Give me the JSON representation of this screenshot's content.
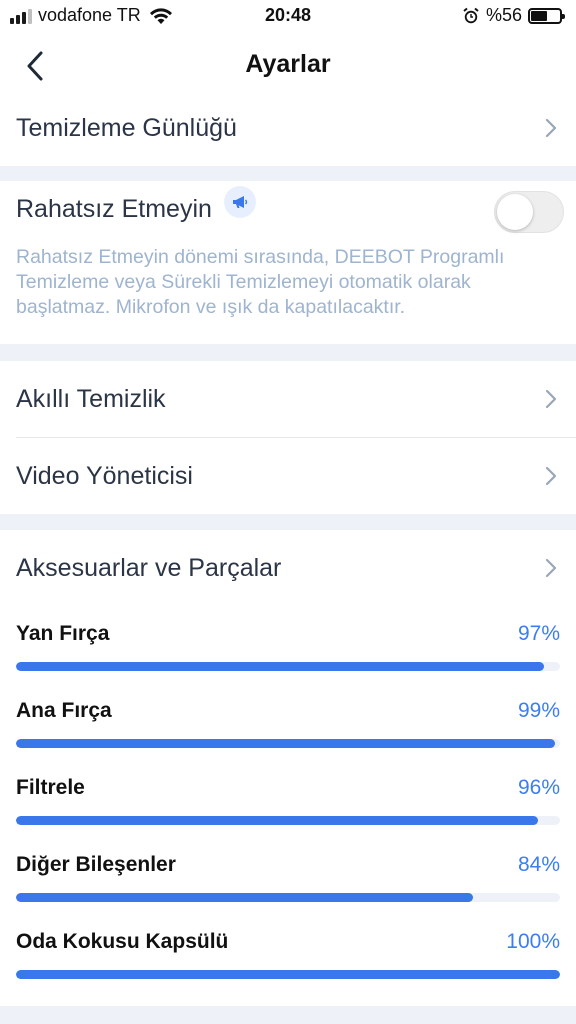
{
  "status_bar": {
    "carrier": "vodafone TR",
    "time": "20:48",
    "battery": "%56",
    "icons": [
      "signal-icon",
      "wifi-icon",
      "alarm-icon",
      "battery-icon"
    ]
  },
  "nav": {
    "title": "Ayarlar",
    "back_icon": "chevron-left-icon"
  },
  "cleaning_log": {
    "label": "Temizleme Günlüğü"
  },
  "do_not_disturb": {
    "label": "Rahatsız Etmeyin",
    "icon": "megaphone-icon",
    "enabled": false,
    "description_lines": [
      "Rahatsız Etmeyin dönemi sırasında, DEEBOT Programlı",
      "Temizleme veya Sürekli Temizlemeyi otomatik olarak",
      "başlatmaz.  Mikrofon ve ışık da kapatılacaktır."
    ]
  },
  "menu": [
    {
      "label": "Akıllı Temizlik"
    },
    {
      "label": "Video Yöneticisi"
    }
  ],
  "accessories": {
    "label": "Aksesuarlar ve Parçalar",
    "items": [
      {
        "name": "Yan Fırça",
        "percent": "97%",
        "level": 0.97
      },
      {
        "name": "Ana Fırça",
        "percent": "99%",
        "level": 0.99
      },
      {
        "name": "Filtrele",
        "percent": "96%",
        "level": 0.96
      },
      {
        "name": "Diğer Bileşenler",
        "percent": "84%",
        "level": 0.84
      },
      {
        "name": "Oda Kokusu Kapsülü",
        "percent": "100%",
        "level": 1.0
      }
    ]
  },
  "colors": {
    "accent": "#3977ea",
    "percent_text": "#3c7ef0",
    "description_text": "#9eb4cf",
    "page_background": "#eef2f8"
  }
}
